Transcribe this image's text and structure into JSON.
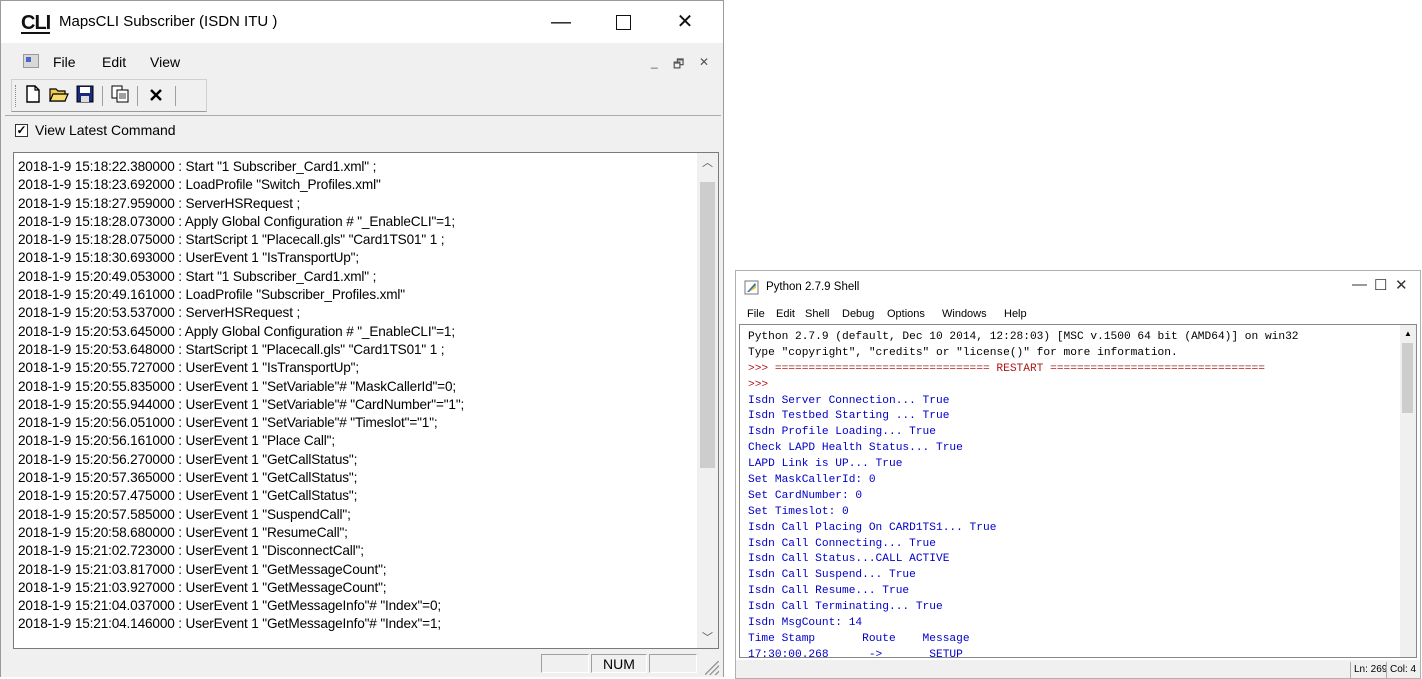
{
  "mapscli": {
    "logo_text": "CLI",
    "title": "MapsCLI Subscriber (ISDN ITU )",
    "window_controls": {
      "minimize": "—",
      "close": "✕"
    },
    "menu": [
      "File",
      "Edit",
      "View"
    ],
    "mdi_controls": {
      "minimize": "_",
      "restore": "🗗",
      "close": "✕"
    },
    "toolbar_icons": [
      "new-file-icon",
      "open-folder-icon",
      "save-icon",
      "copy-icon",
      "delete-icon"
    ],
    "view_latest_command": {
      "label": "View Latest Command",
      "checked": true,
      "check_glyph": "✓"
    },
    "log_lines": [
      "2018-1-9 15:18:22.380000 : Start \"1 Subscriber_Card1.xml\" ;",
      "2018-1-9 15:18:23.692000 : LoadProfile \"Switch_Profiles.xml\"",
      "2018-1-9 15:18:27.959000 : ServerHSRequest ;",
      "2018-1-9 15:18:28.073000 : Apply Global Configuration # \"_EnableCLI\"=1;",
      "2018-1-9 15:18:28.075000 : StartScript 1 \"Placecall.gls\" \"Card1TS01\" 1 ;",
      "2018-1-9 15:18:30.693000 : UserEvent 1 \"IsTransportUp\";",
      "2018-1-9 15:20:49.053000 : Start \"1 Subscriber_Card1.xml\" ;",
      "2018-1-9 15:20:49.161000 : LoadProfile \"Subscriber_Profiles.xml\"",
      "2018-1-9 15:20:53.537000 : ServerHSRequest ;",
      "2018-1-9 15:20:53.645000 : Apply Global Configuration # \"_EnableCLI\"=1;",
      "2018-1-9 15:20:53.648000 : StartScript 1 \"Placecall.gls\" \"Card1TS01\" 1 ;",
      "2018-1-9 15:20:55.727000 : UserEvent 1 \"IsTransportUp\";",
      "2018-1-9 15:20:55.835000 : UserEvent 1 \"SetVariable\"# \"MaskCallerId\"=0;",
      "2018-1-9 15:20:55.944000 : UserEvent 1 \"SetVariable\"# \"CardNumber\"=\"1\";",
      "2018-1-9 15:20:56.051000 : UserEvent 1 \"SetVariable\"# \"Timeslot\"=\"1\";",
      "2018-1-9 15:20:56.161000 : UserEvent 1 \"Place Call\";",
      "2018-1-9 15:20:56.270000 : UserEvent 1 \"GetCallStatus\";",
      "2018-1-9 15:20:57.365000 : UserEvent 1 \"GetCallStatus\";",
      "2018-1-9 15:20:57.475000 : UserEvent 1 \"GetCallStatus\";",
      "2018-1-9 15:20:57.585000 : UserEvent 1 \"SuspendCall\";",
      "2018-1-9 15:20:58.680000 : UserEvent 1 \"ResumeCall\";",
      "2018-1-9 15:21:02.723000 : UserEvent 1 \"DisconnectCall\";",
      "2018-1-9 15:21:03.817000 : UserEvent 1 \"GetMessageCount\";",
      "2018-1-9 15:21:03.927000 : UserEvent 1 \"GetMessageCount\";",
      "2018-1-9 15:21:04.037000 : UserEvent 1 \"GetMessageInfo\"# \"Index\"=0;",
      "2018-1-9 15:21:04.146000 : UserEvent 1 \"GetMessageInfo\"# \"Index\"=1;"
    ],
    "status_panels": [
      "NUM"
    ]
  },
  "python_shell": {
    "title": "Python 2.7.9 Shell",
    "window_controls": {
      "minimize": "—",
      "maximize": "☐",
      "close": "✕"
    },
    "menu": [
      "File",
      "Edit",
      "Shell",
      "Debug",
      "Options",
      "Windows",
      "Help"
    ],
    "colors": {
      "black": "#000000",
      "blue": "#0000c8",
      "red": "#b01818"
    },
    "lines": [
      {
        "text": "Python 2.7.9 (default, Dec 10 2014, 12:28:03) [MSC v.1500 64 bit (AMD64)] on win32",
        "color": "black"
      },
      {
        "text": "Type \"copyright\", \"credits\" or \"license()\" for more information.",
        "color": "black"
      },
      {
        "text": ">>> ================================ RESTART ================================",
        "color": "red"
      },
      {
        "text": ">>> ",
        "color": "red"
      },
      {
        "text": "Isdn Server Connection... True",
        "color": "blue"
      },
      {
        "text": "Isdn Testbed Starting ... True",
        "color": "blue"
      },
      {
        "text": "Isdn Profile Loading... True",
        "color": "blue"
      },
      {
        "text": "Check LAPD Health Status... True",
        "color": "blue"
      },
      {
        "text": "LAPD Link is UP... True",
        "color": "blue"
      },
      {
        "text": "Set MaskCallerId: 0",
        "color": "blue"
      },
      {
        "text": "Set CardNumber: 0",
        "color": "blue"
      },
      {
        "text": "Set Timeslot: 0",
        "color": "blue"
      },
      {
        "text": "Isdn Call Placing On CARD1TS1... True",
        "color": "blue"
      },
      {
        "text": "Isdn Call Connecting... True",
        "color": "blue"
      },
      {
        "text": "Isdn Call Status...CALL ACTIVE",
        "color": "blue"
      },
      {
        "text": "Isdn Call Suspend... True",
        "color": "blue"
      },
      {
        "text": "Isdn Call Resume... True",
        "color": "blue"
      },
      {
        "text": "Isdn Call Terminating... True",
        "color": "blue"
      },
      {
        "text": "Isdn MsgCount: 14",
        "color": "blue"
      },
      {
        "text": "Time Stamp       Route    Message",
        "color": "blue"
      },
      {
        "text": "17:30:00.268      ->       SETUP",
        "color": "blue"
      }
    ],
    "status": {
      "line": "Ln: 269",
      "col": "Col: 4"
    }
  }
}
